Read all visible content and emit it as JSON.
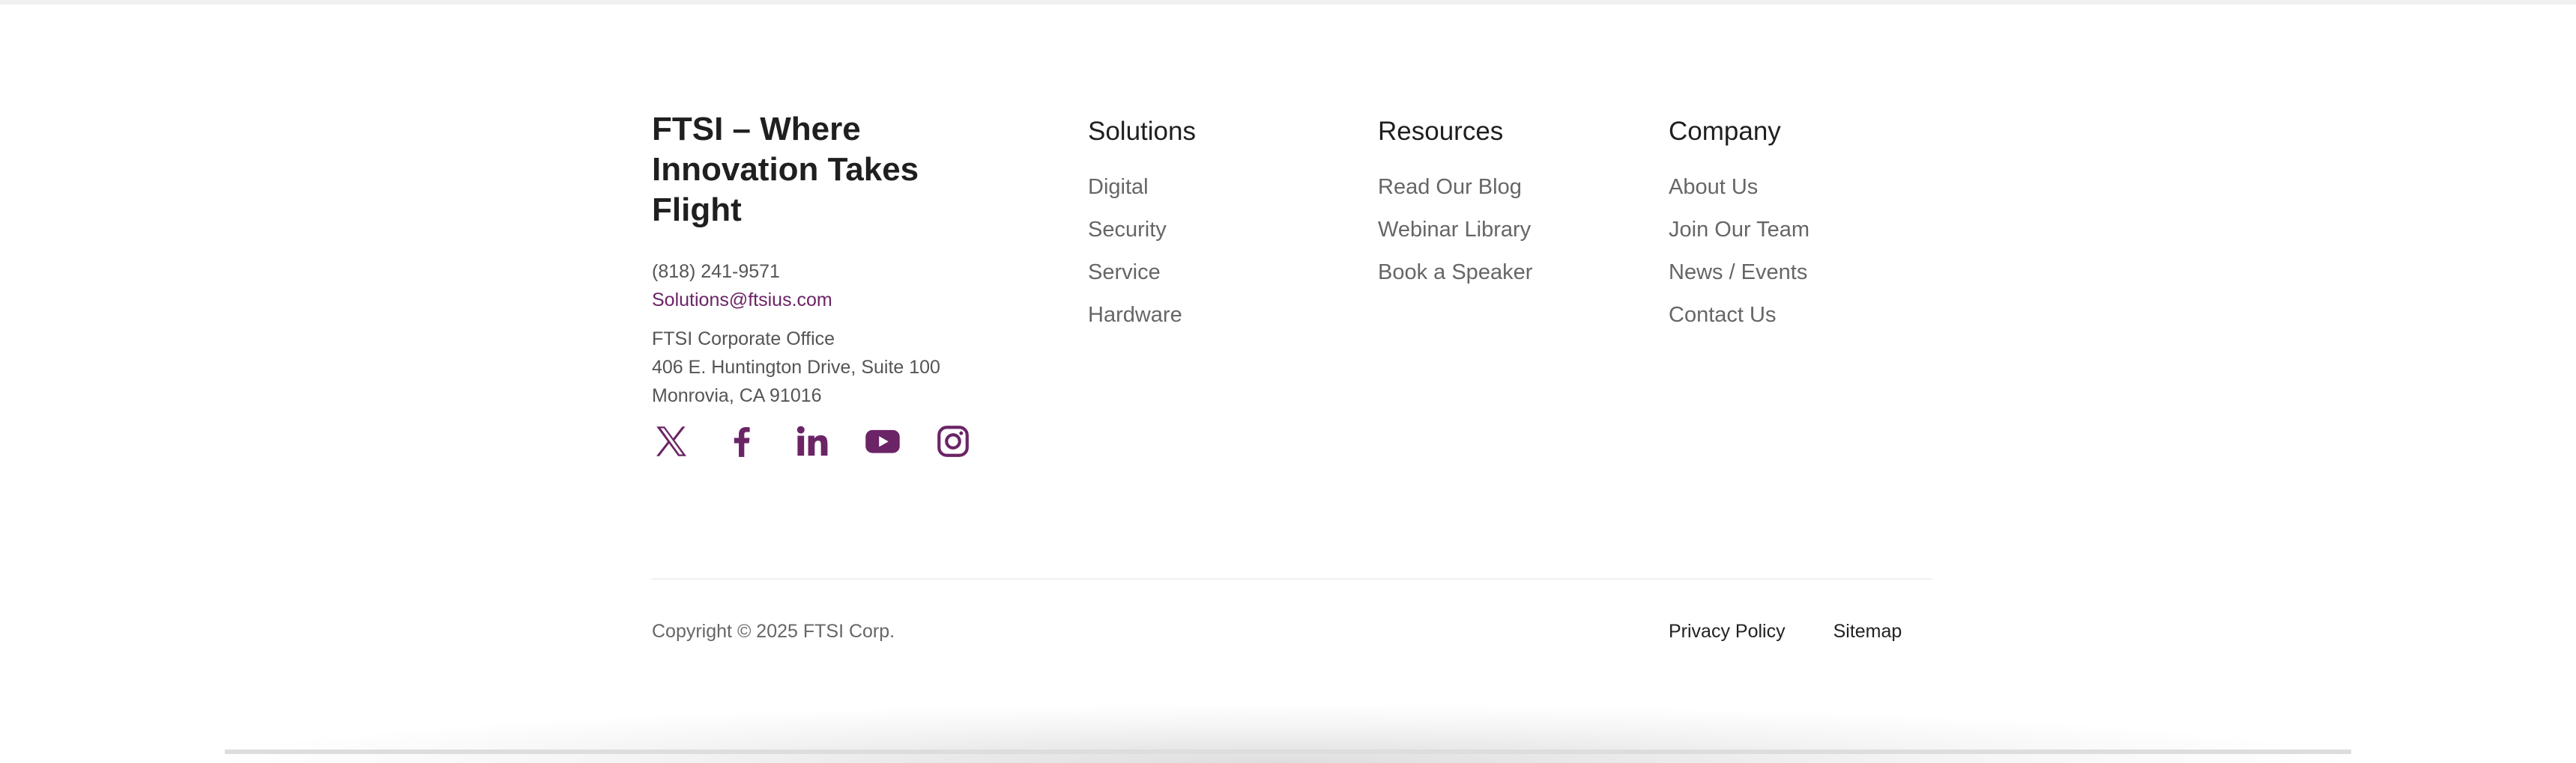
{
  "brand": {
    "title": "FTSI – Where Innovation Takes Flight",
    "phone": "(818) 241-9571",
    "email": "Solutions@ftsius.com",
    "address": [
      "FTSI Corporate Office",
      "406 E. Huntington Drive, Suite 100",
      "Monrovia, CA 91016"
    ],
    "accent_color": "#6b2466"
  },
  "social": [
    {
      "name": "x-icon"
    },
    {
      "name": "facebook-icon"
    },
    {
      "name": "linkedin-icon"
    },
    {
      "name": "youtube-icon"
    },
    {
      "name": "instagram-icon"
    }
  ],
  "columns": {
    "solutions": {
      "heading": "Solutions",
      "links": [
        "Digital",
        "Security",
        "Service",
        "Hardware"
      ]
    },
    "resources": {
      "heading": "Resources",
      "links": [
        "Read Our Blog",
        "Webinar Library",
        "Book a Speaker"
      ]
    },
    "company": {
      "heading": "Company",
      "links": [
        "About Us",
        "Join Our Team",
        "News / Events",
        "Contact Us"
      ]
    }
  },
  "bottom": {
    "copyright": "Copyright © 2025 FTSI Corp.",
    "links": [
      "Privacy Policy",
      "Sitemap"
    ]
  }
}
